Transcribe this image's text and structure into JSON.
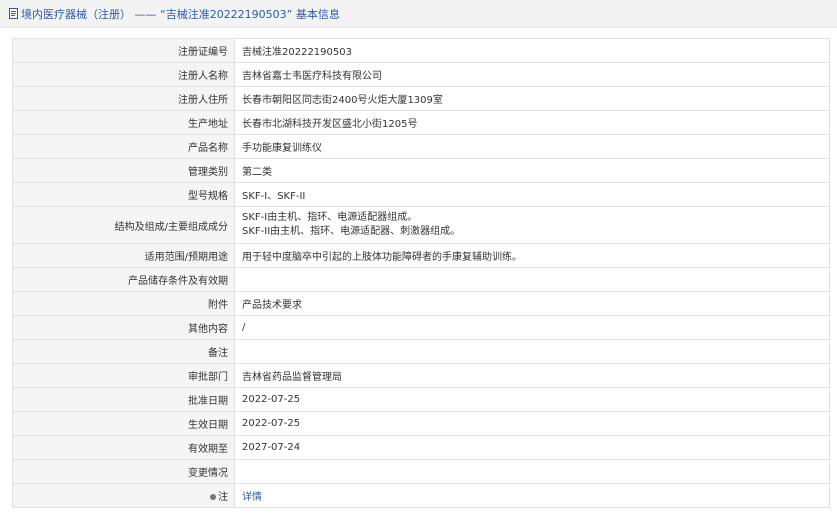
{
  "header": {
    "title": "境内医疗器械（注册） —— “吉械注准20222190503” 基本信息"
  },
  "rows": [
    {
      "label": "注册证编号",
      "value": "吉械注准20222190503"
    },
    {
      "label": "注册人名称",
      "value": "吉林省嘉士韦医疗科技有限公司"
    },
    {
      "label": "注册人住所",
      "value": "长春市朝阳区同志街2400号火炬大厦1309室"
    },
    {
      "label": "生产地址",
      "value": "长春市北湖科技开发区盛北小街1205号"
    },
    {
      "label": "产品名称",
      "value": "手功能康复训练仪"
    },
    {
      "label": "管理类别",
      "value": "第二类"
    },
    {
      "label": "型号规格",
      "value": "SKF-I、SKF-II"
    },
    {
      "label": "结构及组成/主要组成成分",
      "lines": [
        "SKF-I由主机、指环、电源适配器组成。",
        "SKF-II由主机、指环、电源适配器、刺激器组成。"
      ]
    },
    {
      "label": "适用范围/预期用途",
      "value": "用于轻中度脑卒中引起的上肢体功能障碍者的手康复辅助训练。"
    },
    {
      "label": "产品储存条件及有效期",
      "value": ""
    },
    {
      "label": "附件",
      "value": "产品技术要求"
    },
    {
      "label": "其他内容",
      "value": "/"
    },
    {
      "label": "备注",
      "value": ""
    },
    {
      "label": "审批部门",
      "value": "吉林省药品监督管理局"
    },
    {
      "label": "批准日期",
      "value": "2022-07-25"
    },
    {
      "label": "生效日期",
      "value": "2022-07-25"
    },
    {
      "label": "有效期至",
      "value": "2027-07-24"
    },
    {
      "label": "变更情况",
      "value": ""
    },
    {
      "label": "注",
      "value": "详情"
    }
  ]
}
